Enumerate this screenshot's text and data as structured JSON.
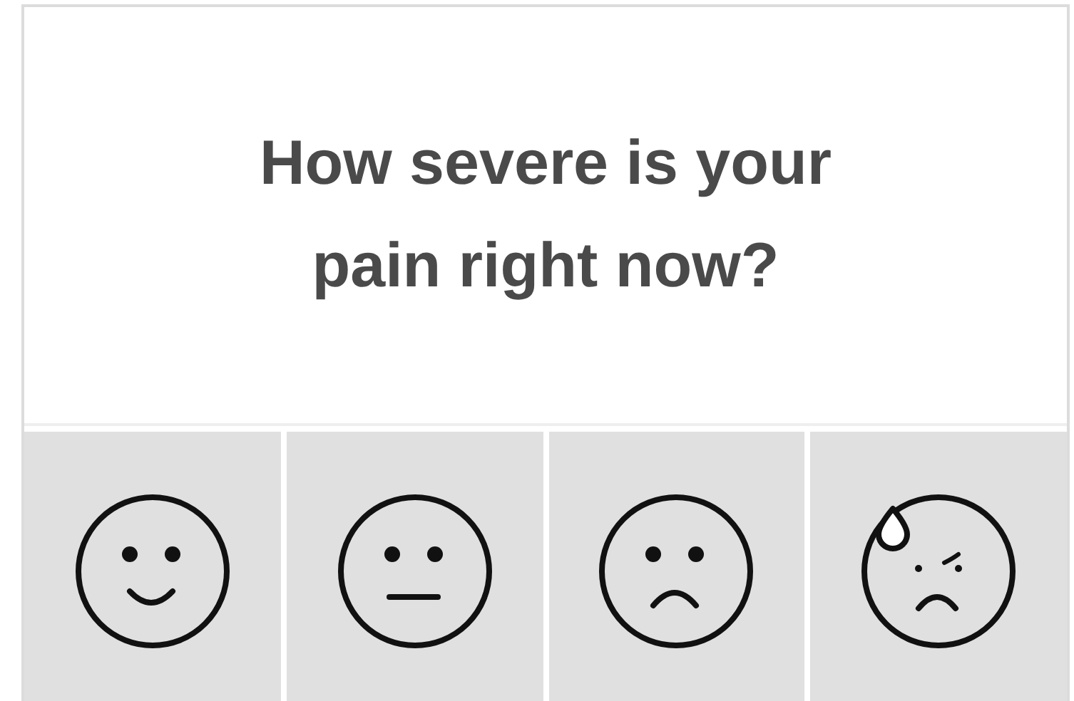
{
  "question": "How severe is your pain right now?",
  "options": [
    {
      "kind": "smile"
    },
    {
      "kind": "neutral"
    },
    {
      "kind": "frown"
    },
    {
      "kind": "sweat"
    }
  ]
}
